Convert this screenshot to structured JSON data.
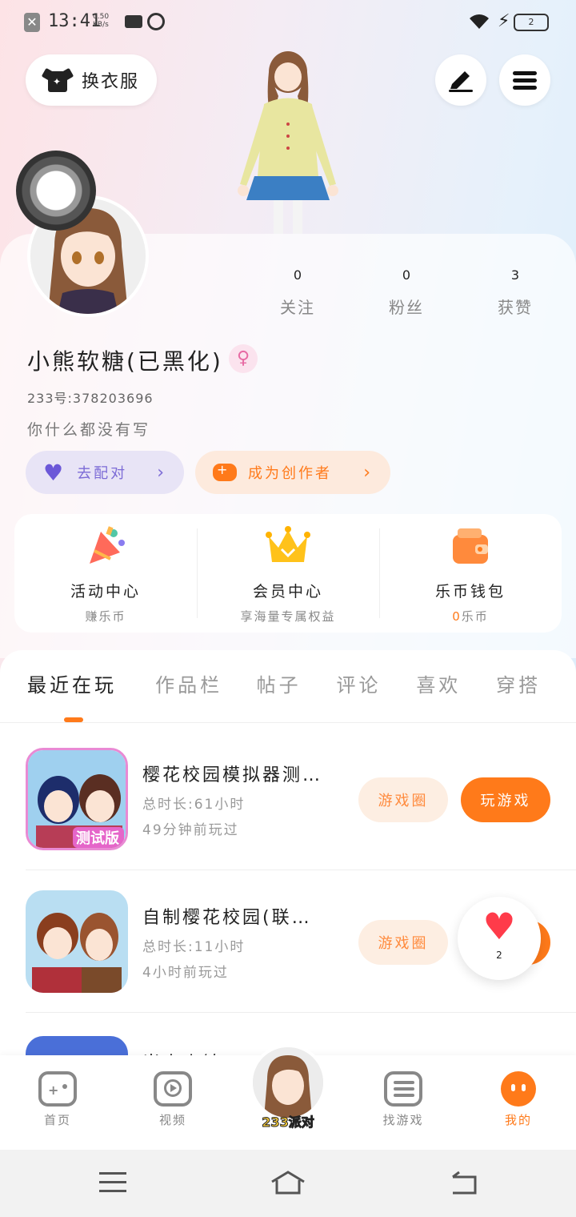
{
  "status_bar": {
    "time": "13:41",
    "network_speed": "0.50",
    "network_unit": "KB/s",
    "battery": "2"
  },
  "header": {
    "wardrobe_label": "换衣服",
    "edit_icon": "pen-icon",
    "menu_icon": "menu-icon"
  },
  "profile": {
    "stats": [
      {
        "value": "0",
        "label": "关注"
      },
      {
        "value": "0",
        "label": "粉丝"
      },
      {
        "value": "3",
        "label": "获赞"
      }
    ],
    "nickname": "小熊软糖(已黑化)",
    "gender_symbol": "♀",
    "uid": "233号:378203696",
    "bio": "你什么都没有写",
    "match_label": "去配对",
    "creator_label": "成为创作者"
  },
  "functions": [
    {
      "title": "活动中心",
      "subtitle": "赚乐币",
      "icon": "party-popper-icon"
    },
    {
      "title": "会员中心",
      "subtitle": "享海量专属权益",
      "icon": "crown-icon"
    },
    {
      "title": "乐币钱包",
      "subtitle_value": "0",
      "subtitle_suffix": "乐币",
      "icon": "wallet-icon"
    }
  ],
  "tabs": [
    "最近在玩",
    "作品栏",
    "帖子",
    "评论",
    "喜欢",
    "穿搭"
  ],
  "games": [
    {
      "name": "樱花校园模拟器测…",
      "total_time": "总时长:61小时",
      "last_played": "49分钟前玩过",
      "badge": "测试版",
      "circle_label": "游戏圈",
      "play_label": "玩游戏"
    },
    {
      "name": "自制樱花校园(联…",
      "total_time": "总时长:11小时",
      "last_played": "4小时前玩过",
      "circle_label": "游戏圈"
    },
    {
      "name": "当人小镇"
    }
  ],
  "like_float": {
    "count": "2"
  },
  "bottom_nav": {
    "home": "首页",
    "video": "视频",
    "center_logo": "233派对",
    "find_game": "找游戏",
    "mine": "我的"
  },
  "colors": {
    "accent": "#ff7a1a",
    "purple": "#7c6bd6",
    "pink": "#e76aa3"
  }
}
